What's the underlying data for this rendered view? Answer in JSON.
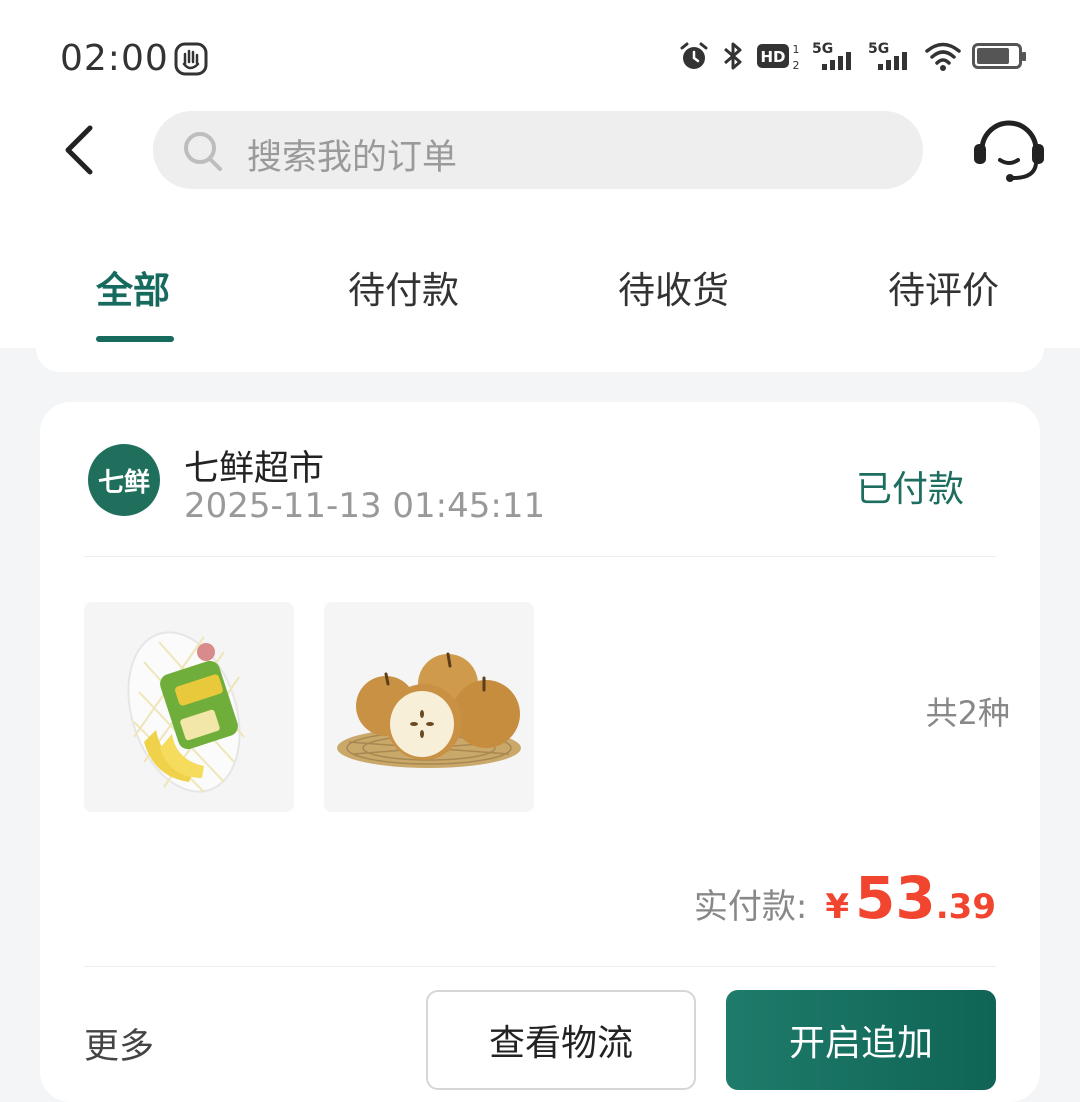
{
  "status_bar": {
    "time": "02:00",
    "network_labels": [
      "HD",
      "5G",
      "5G"
    ]
  },
  "search": {
    "placeholder": "搜索我的订单"
  },
  "tabs": [
    {
      "label": "全部",
      "active": true
    },
    {
      "label": "待付款",
      "active": false
    },
    {
      "label": "待收货",
      "active": false
    },
    {
      "label": "待评价",
      "active": false
    }
  ],
  "order": {
    "shop_name": "七鲜超市",
    "shop_logo_text": "七鲜",
    "time": "2025-11-13 01:45:11",
    "status": "已付款",
    "item_count": "共2种",
    "items": [
      {
        "icon": "banana-bag-image"
      },
      {
        "icon": "pear-basket-image"
      }
    ],
    "payment_label": "实付款:",
    "currency": "¥",
    "amount_int": "53",
    "amount_dec": ".39",
    "more_label": "更多",
    "btn_logistics": "查看物流",
    "btn_add": "开启追加"
  },
  "colors": {
    "brand": "#176b5e",
    "price": "#f2452f"
  }
}
